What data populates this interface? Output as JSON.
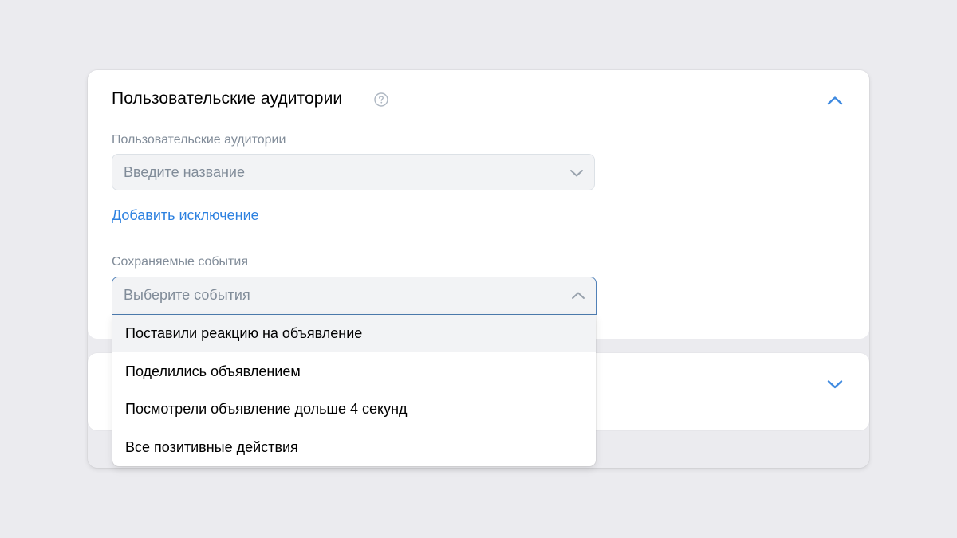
{
  "audiences_section": {
    "title": "Пользовательские аудитории",
    "help_icon": "question-circle-icon",
    "collapse_icon": "chevron-up-icon",
    "audiences_field": {
      "label": "Пользовательские аудитории",
      "placeholder": "Введите название",
      "chevron_icon": "chevron-down-icon"
    },
    "add_exclusion_link": "Добавить исключение",
    "events_field": {
      "label": "Сохраняемые события",
      "placeholder": "Выберите события",
      "chevron_icon": "chevron-up-icon",
      "options": [
        "Поставили реакцию на объявление",
        "Поделились объявлением",
        "Посмотрели объявление дольше 4 секунд",
        "Все позитивные действия"
      ],
      "highlighted_option_index": 0
    }
  },
  "second_section": {
    "expand_icon": "chevron-down-icon"
  },
  "colors": {
    "page_background": "#ebebef",
    "card_background": "#ffffff",
    "accent": "#2d81e0",
    "chevron": "#3f8ae0",
    "muted_text": "#818c99",
    "input_background": "#f2f3f5",
    "focus_border": "#5181b8"
  }
}
